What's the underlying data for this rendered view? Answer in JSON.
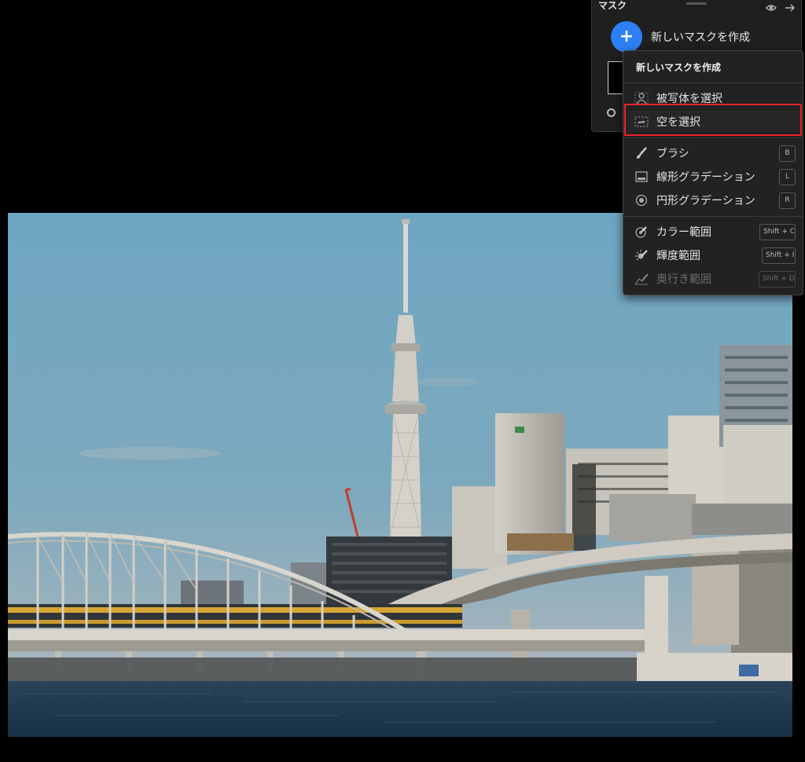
{
  "panel": {
    "title": "マスク",
    "create_mask_label": "新しいマスクを作成",
    "plus_symbol": "+"
  },
  "dropdown": {
    "title": "新しいマスクを作成",
    "items": [
      {
        "label": "被写体を選択",
        "icon": "subject-icon",
        "shortcut": ""
      },
      {
        "label": "空を選択",
        "icon": "sky-icon",
        "shortcut": "",
        "highlighted": true
      },
      {
        "label": "ブラシ",
        "icon": "brush-icon",
        "shortcut": "B"
      },
      {
        "label": "線形グラデーション",
        "icon": "linear-gradient-icon",
        "shortcut": "L"
      },
      {
        "label": "円形グラデーション",
        "icon": "radial-gradient-icon",
        "shortcut": "R"
      },
      {
        "label": "カラー範囲",
        "icon": "color-range-icon",
        "shortcut": "Shift + C"
      },
      {
        "label": "輝度範囲",
        "icon": "luminance-range-icon",
        "shortcut": "Shift + I"
      },
      {
        "label": "奥行き範囲",
        "icon": "depth-range-icon",
        "shortcut": "Shift + D",
        "disabled": true
      }
    ]
  },
  "colors": {
    "accent": "#2d7ff5",
    "highlight": "#e8232a",
    "panel_bg": "#1f1f1f"
  }
}
